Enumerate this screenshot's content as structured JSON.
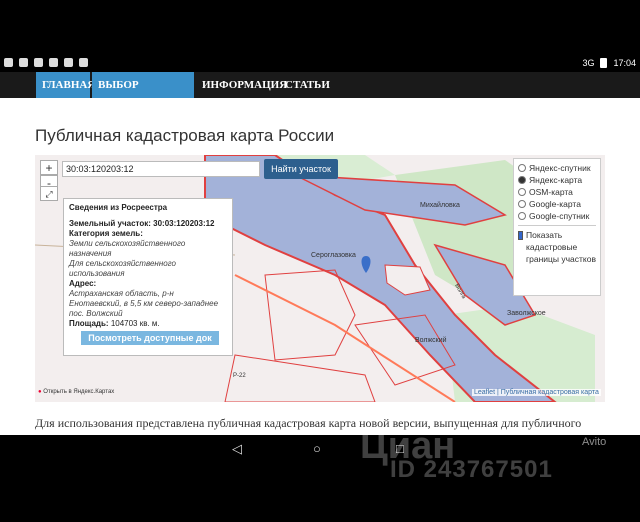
{
  "status_bar": {
    "network": "3G",
    "time": "17:04"
  },
  "nav": {
    "items": [
      {
        "label": "ГЛАВНАЯ",
        "active": true,
        "chevron": false
      },
      {
        "label": "ВЫБОР РЕГИОНА",
        "active": true,
        "chevron": true
      },
      {
        "label": "ИНФОРМАЦИЯ",
        "active": false,
        "chevron": false
      },
      {
        "label": "СТАТЬИ",
        "active": false,
        "chevron": true
      }
    ]
  },
  "page": {
    "title": "Публичная кадастровая карта России",
    "body_text": "Для использования представлена публичная кадастровая карта новой версии, выпущенная для публичного"
  },
  "map": {
    "search_value": "30:03:120203:12",
    "find_button": "Найти участок",
    "zoom_in": "+",
    "zoom_out": "-",
    "fullscreen": "⤢",
    "popup": {
      "header": "Сведения из Росреестра",
      "parcel_label": "Земельный участок:",
      "parcel_value": "30:03:120203:12",
      "category_label": "Категория земель:",
      "category_value": "Земли сельскохозяйственного назначения",
      "use_value": "Для сельскохозяйственного использования",
      "address_label": "Адрес:",
      "address_value": "Астраханская область, р-н Енотаевский, в 5,5 км северо-западнее пос. Волжский",
      "area_label": "Площадь:",
      "area_value": "104703 кв. м.",
      "button": "Посмотреть доступные док"
    },
    "layers": [
      {
        "label": "Яндекс-спутник",
        "selected": false
      },
      {
        "label": "Яндекс-карта",
        "selected": true
      },
      {
        "label": "OSM-карта",
        "selected": false
      },
      {
        "label": "Google-карта",
        "selected": false
      },
      {
        "label": "Google-спутник",
        "selected": false
      }
    ],
    "cadastral_toggle": "Показать кадастровые границы участков",
    "attribution": "Leaflet | Публичная кадастровая карта",
    "yandex_link": "Открыть в Яндекс.Картах",
    "place_labels": [
      "Сероглазовка",
      "Волжский",
      "Заволжское",
      "Михайловка"
    ],
    "road_label": "Р-22",
    "river_label": "Волга"
  },
  "watermark": {
    "brand": "Циан",
    "id_text": "ID 243767501",
    "avito": "Avito"
  },
  "colors": {
    "nav_bg": "#1a1a1a",
    "nav_active": "#3a90c9",
    "river": "#a3b2d9",
    "parcel_line": "#e04040",
    "road": "#ff7a59"
  }
}
